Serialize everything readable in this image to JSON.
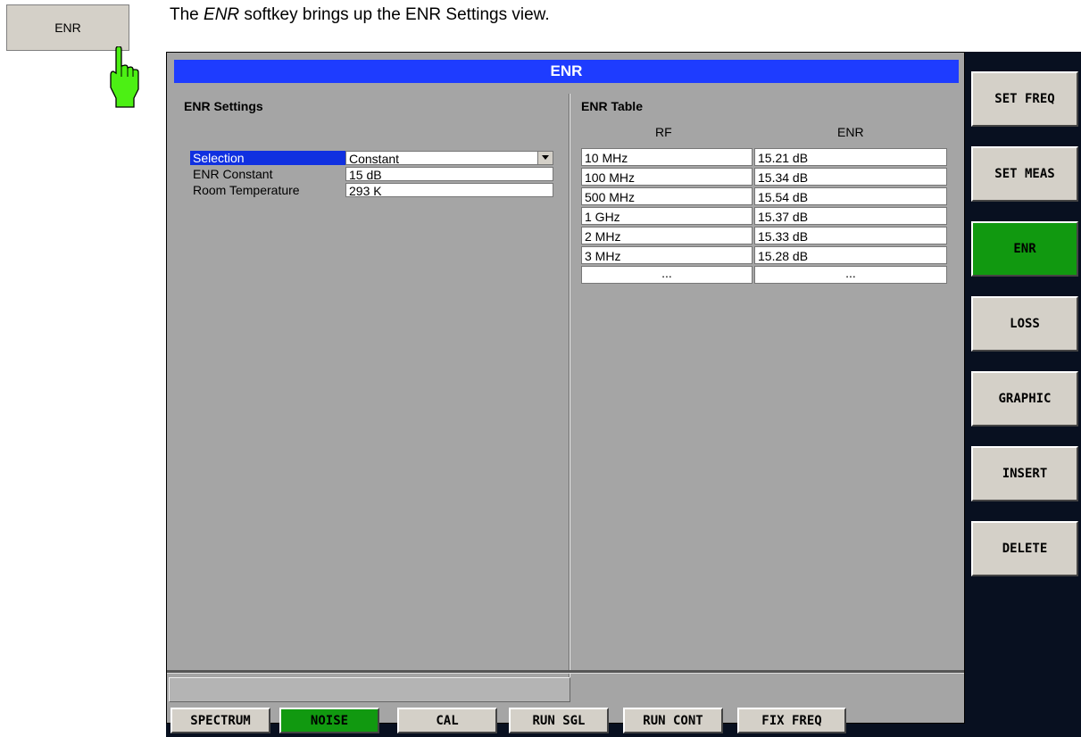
{
  "softkey": {
    "label": "ENR"
  },
  "caption": {
    "prefix": "The ",
    "italic": "ENR",
    "suffix": " softkey brings up the ENR Settings view."
  },
  "window": {
    "title": "ENR"
  },
  "settings": {
    "title": "ENR Settings",
    "rows": [
      {
        "label": "Selection",
        "value": "Constant"
      },
      {
        "label": "ENR Constant",
        "value": "15 dB"
      },
      {
        "label": "Room Temperature",
        "value": "293 K"
      }
    ]
  },
  "table": {
    "title": "ENR Table",
    "col_rf": "RF",
    "col_enr": "ENR",
    "rows": [
      {
        "rf": "10 MHz",
        "enr": "15.21 dB"
      },
      {
        "rf": "100 MHz",
        "enr": "15.34 dB"
      },
      {
        "rf": "500 MHz",
        "enr": "15.54 dB"
      },
      {
        "rf": "1 GHz",
        "enr": "15.37 dB"
      },
      {
        "rf": "2 MHz",
        "enr": "15.33 dB"
      },
      {
        "rf": "3 MHz",
        "enr": "15.28 dB"
      },
      {
        "rf": "...",
        "enr": "..."
      }
    ]
  },
  "sidebar": {
    "items": [
      {
        "label": "SET FREQ"
      },
      {
        "label": "SET MEAS"
      },
      {
        "label": "ENR"
      },
      {
        "label": "LOSS"
      },
      {
        "label": "GRAPHIC"
      },
      {
        "label": "INSERT"
      },
      {
        "label": "DELETE"
      }
    ]
  },
  "bottom": {
    "items": [
      {
        "label": "SPECTRUM"
      },
      {
        "label": "NOISE"
      },
      {
        "label": "CAL"
      },
      {
        "label": "RUN SGL"
      },
      {
        "label": "RUN CONT"
      },
      {
        "label": "FIX FREQ"
      }
    ]
  },
  "colors": {
    "title_bar": "#1e3cff",
    "active_green": "#119910",
    "selection_blue": "#1030e0",
    "panel_gray": "#a5a5a5",
    "dark_frame": "#081020"
  },
  "icons": {
    "dropdown": "dropdown-arrow-icon",
    "hand": "pointing-hand-icon"
  }
}
